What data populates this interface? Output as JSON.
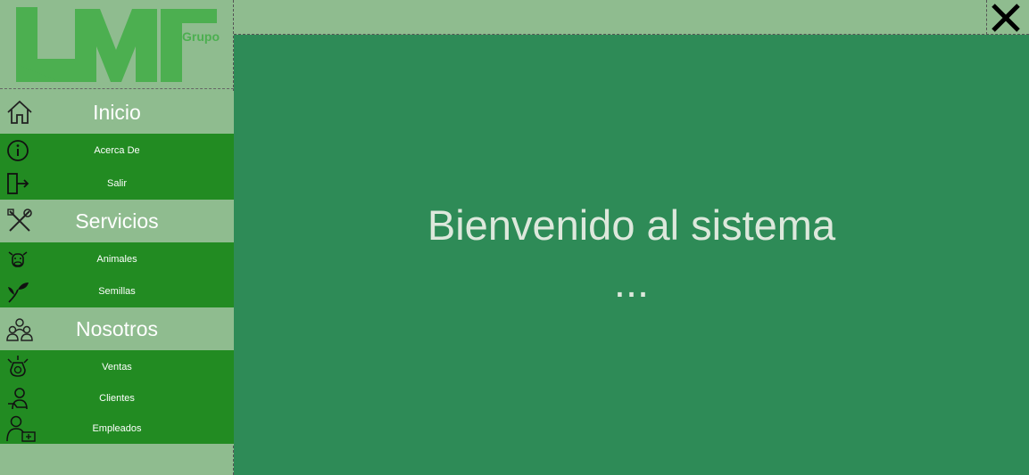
{
  "logo": {
    "main_text": "LMF",
    "sub_text": "Grupo"
  },
  "sections": [
    {
      "label": "Inicio",
      "icon": "home-icon",
      "items": [
        {
          "label": "Acerca De",
          "icon": "info-icon"
        },
        {
          "label": "Salir",
          "icon": "exit-icon"
        }
      ]
    },
    {
      "label": "Servicios",
      "icon": "tools-icon",
      "items": [
        {
          "label": "Animales",
          "icon": "cow-icon"
        },
        {
          "label": "Semillas",
          "icon": "seedling-icon"
        }
      ]
    },
    {
      "label": "Nosotros",
      "icon": "team-icon",
      "items": [
        {
          "label": "Ventas",
          "icon": "money-bag-icon"
        },
        {
          "label": "Clientes",
          "icon": "client-icon"
        },
        {
          "label": "Empleados",
          "icon": "employee-icon"
        }
      ]
    }
  ],
  "main": {
    "welcome_line1": "Bienvenido al sistema",
    "welcome_line2": "..."
  },
  "window": {
    "close_icon": "close-icon"
  },
  "colors": {
    "sidebar_bg": "#8fbc8f",
    "submenu_bg": "#228b22",
    "main_bg": "#2e8b57",
    "logo_green": "#4caf50"
  }
}
